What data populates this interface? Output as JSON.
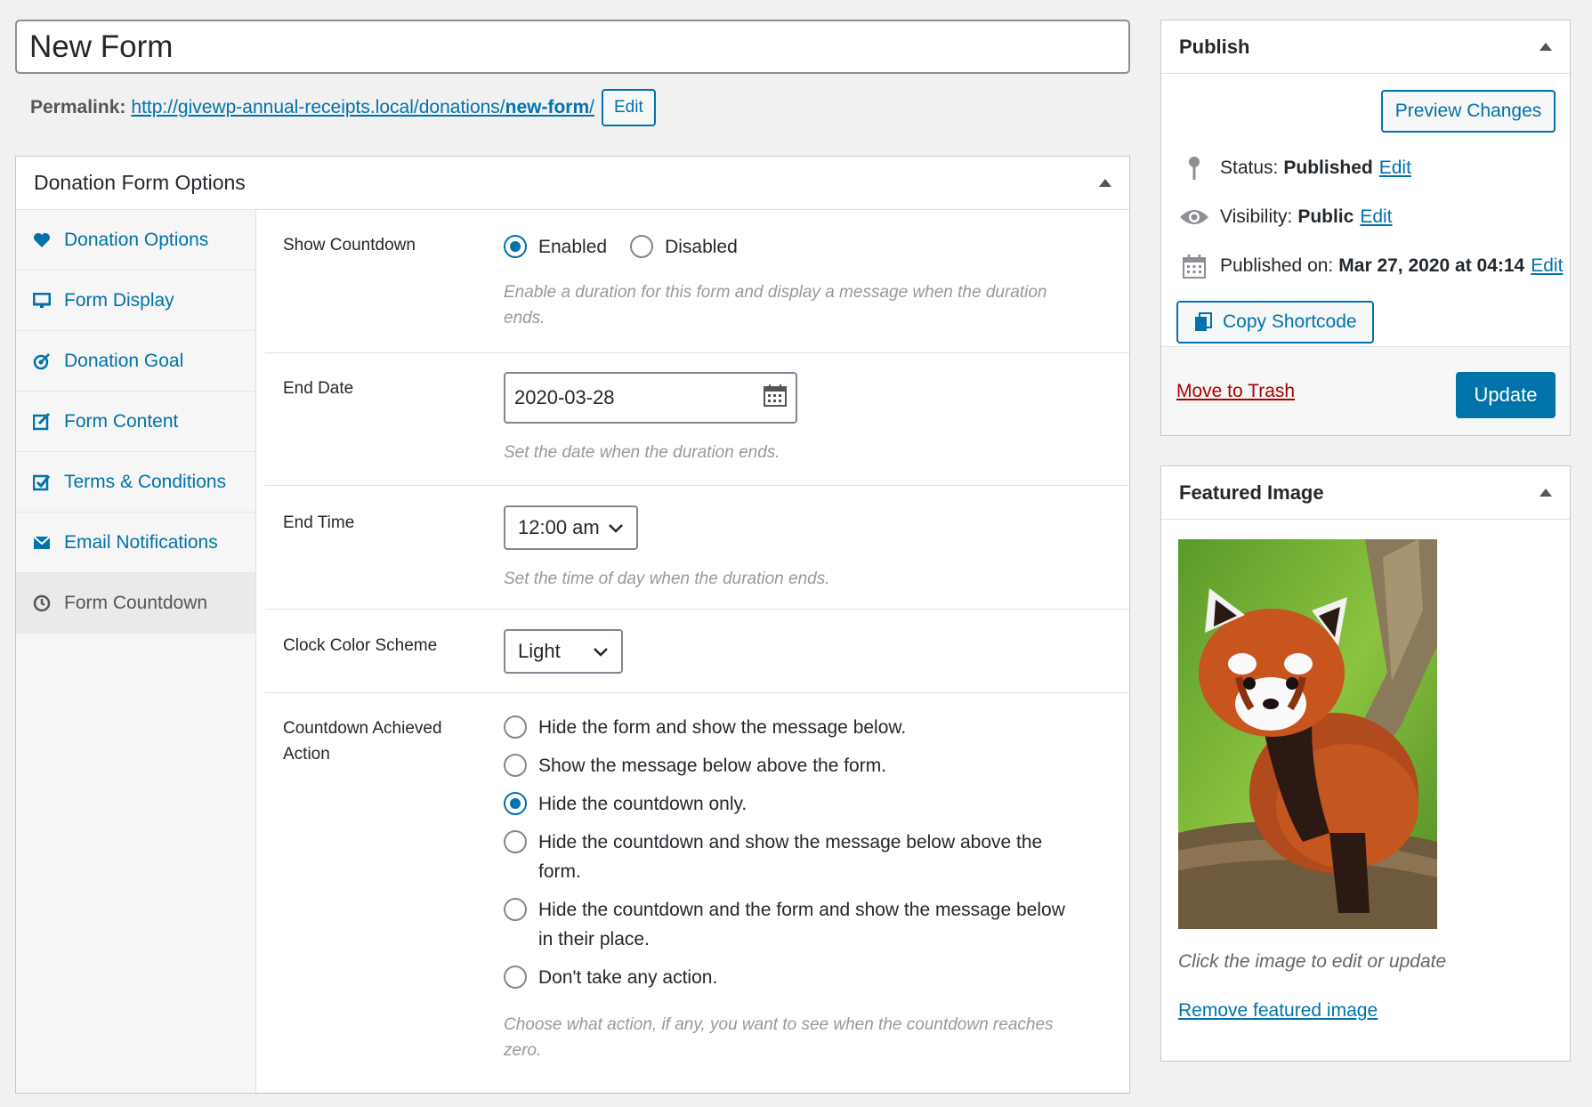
{
  "title": "New Form",
  "permalink": {
    "label": "Permalink:",
    "url_base": "http://givewp-annual-receipts.local/donations/",
    "url_slug": "new-form",
    "url_end": "/",
    "edit_label": "Edit"
  },
  "options_box": {
    "title": "Donation Form Options",
    "tabs": [
      {
        "label": "Donation Options",
        "icon": "heart-icon"
      },
      {
        "label": "Form Display",
        "icon": "monitor-icon"
      },
      {
        "label": "Donation Goal",
        "icon": "target-icon"
      },
      {
        "label": "Form Content",
        "icon": "edit-icon"
      },
      {
        "label": "Terms & Conditions",
        "icon": "checkbox-icon"
      },
      {
        "label": "Email Notifications",
        "icon": "envelope-icon"
      },
      {
        "label": "Form Countdown",
        "icon": "clock-icon"
      }
    ],
    "active_tab": "Form Countdown",
    "fields": {
      "show_countdown": {
        "label": "Show Countdown",
        "options": [
          "Enabled",
          "Disabled"
        ],
        "selected": "Enabled",
        "description": "Enable a duration for this form and display a message when the duration ends."
      },
      "end_date": {
        "label": "End Date",
        "value": "2020-03-28",
        "description": "Set the date when the duration ends."
      },
      "end_time": {
        "label": "End Time",
        "value": "12:00 am",
        "description": "Set the time of day when the duration ends."
      },
      "clock_color": {
        "label": "Clock Color Scheme",
        "value": "Light"
      },
      "achieved_action": {
        "label": "Countdown Achieved Action",
        "options": [
          "Hide the form and show the message below.",
          "Show the message below above the form.",
          "Hide the countdown only.",
          "Hide the countdown and show the message below above the form.",
          "Hide the countdown and the form and show the message below in their place.",
          "Don't take any action."
        ],
        "selected": "Hide the countdown only.",
        "description": "Choose what action, if any, you want to see when the countdown reaches zero."
      }
    }
  },
  "publish": {
    "title": "Publish",
    "preview_label": "Preview Changes",
    "status_label": "Status:",
    "status_value": "Published",
    "visibility_label": "Visibility:",
    "visibility_value": "Public",
    "published_label": "Published on:",
    "published_value": "Mar 27, 2020 at 04:14",
    "edit_label": "Edit",
    "copy_label": "Copy Shortcode",
    "trash_label": "Move to Trash",
    "update_label": "Update"
  },
  "featured_image": {
    "title": "Featured Image",
    "caption": "Click the image to edit or update",
    "remove_label": "Remove featured image"
  },
  "colors": {
    "accent": "#0073aa",
    "danger": "#a00",
    "background": "#f1f1f1"
  }
}
